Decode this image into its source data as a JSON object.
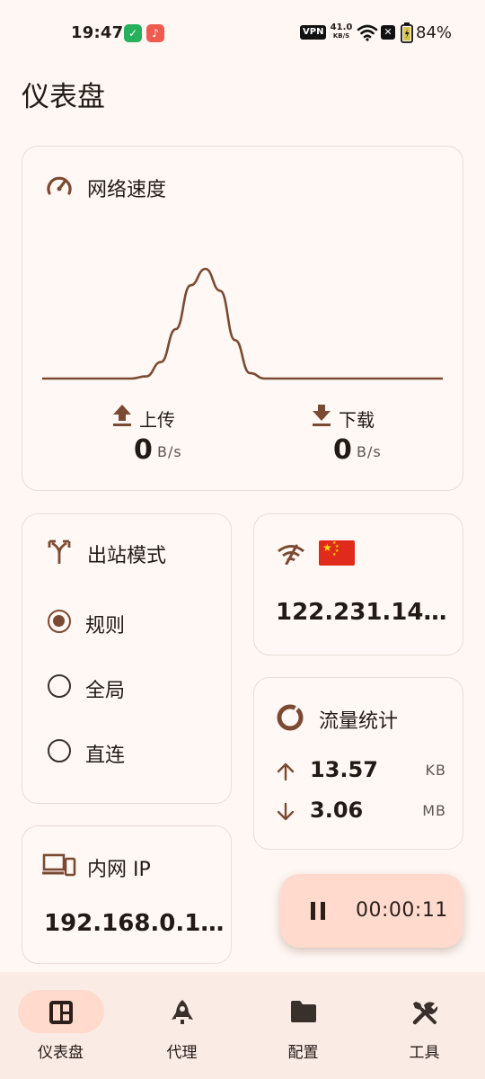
{
  "status_bar": {
    "time": "19:47",
    "vpn_badge": "VPN",
    "net_speed_value": "41.0",
    "net_speed_unit": "KB/S",
    "battery": "84%"
  },
  "page": {
    "title": "仪表盘"
  },
  "network_speed": {
    "title": "网络速度",
    "upload_label": "上传",
    "upload_value": "0",
    "upload_unit": "B/s",
    "download_label": "下载",
    "download_value": "0",
    "download_unit": "B/s",
    "chart_data": {
      "type": "line",
      "series": [
        {
          "values": [
            0,
            0,
            0,
            0,
            0,
            0,
            0,
            0.02,
            0.15,
            0.45,
            0.85,
            1.0,
            0.8,
            0.35,
            0.05,
            0,
            0,
            0,
            0,
            0,
            0,
            0,
            0,
            0,
            0,
            0,
            0,
            0
          ]
        }
      ]
    }
  },
  "outbound_mode": {
    "title": "出站模式",
    "options": [
      {
        "label": "规则",
        "selected": true
      },
      {
        "label": "全局",
        "selected": false
      },
      {
        "label": "直连",
        "selected": false
      }
    ]
  },
  "public_ip": {
    "flag_icon": "china-flag-icon",
    "value": "122.231.14…"
  },
  "traffic_stats": {
    "title": "流量统计",
    "upload_value": "13.57",
    "upload_unit": "KB",
    "download_value": "3.06",
    "download_unit": "MB"
  },
  "lan_ip": {
    "title": "内网 IP",
    "value": "192.168.0.1…"
  },
  "fab": {
    "icon": "pause-icon",
    "timer": "00:00:11"
  },
  "bottom_nav": {
    "items": [
      {
        "label": "仪表盘",
        "icon": "dashboard-icon",
        "active": true
      },
      {
        "label": "代理",
        "icon": "rocket-icon",
        "active": false
      },
      {
        "label": "配置",
        "icon": "folder-icon",
        "active": false
      },
      {
        "label": "工具",
        "icon": "tools-icon",
        "active": false
      }
    ]
  },
  "colors": {
    "background": "#fff7f3",
    "accent": "#7b4a32",
    "card_border": "#eaddd7",
    "fab": "#ffdacd",
    "nav_bar": "#faebe5"
  }
}
